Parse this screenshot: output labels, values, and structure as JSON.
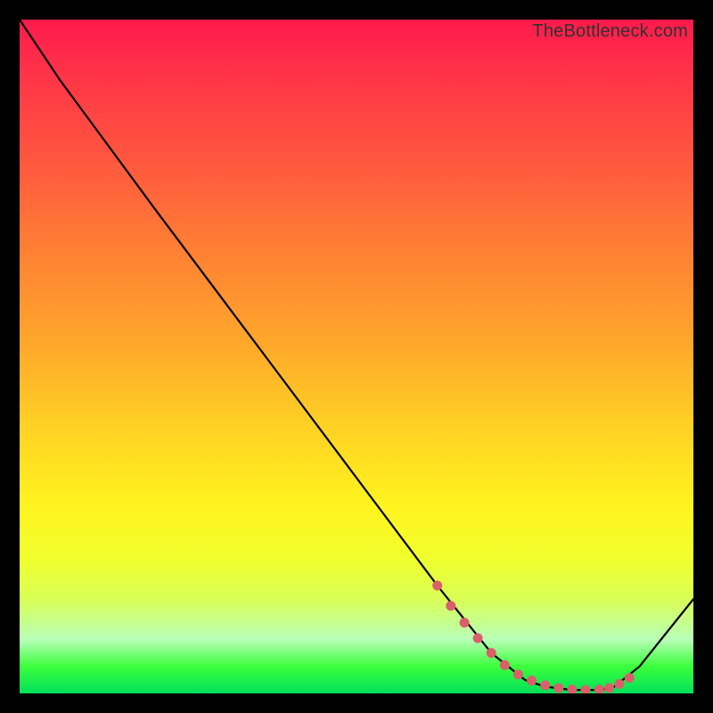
{
  "watermark": "TheBottleneck.com",
  "chart_data": {
    "type": "line",
    "title": "",
    "xlabel": "",
    "ylabel": "",
    "xlim": [
      0,
      100
    ],
    "ylim": [
      0,
      100
    ],
    "series": [
      {
        "name": "curve",
        "x": [
          0,
          6,
          20,
          35,
          50,
          62,
          70,
          75,
          78,
          82,
          86,
          88,
          92,
          100
        ],
        "y": [
          100,
          91,
          72,
          52,
          32,
          16,
          6,
          2,
          1,
          0.5,
          0.5,
          0.8,
          4,
          14
        ]
      }
    ],
    "markers": {
      "name": "highlight-dots",
      "color": "#d9606a",
      "x": [
        62,
        64,
        66,
        68,
        70,
        72,
        74,
        76,
        78,
        80,
        82,
        84,
        86,
        87.5,
        89,
        90.5
      ],
      "y": [
        16,
        13,
        10.5,
        8.2,
        6.0,
        4.2,
        2.8,
        1.9,
        1.2,
        0.8,
        0.55,
        0.5,
        0.55,
        0.8,
        1.4,
        2.3
      ]
    }
  }
}
